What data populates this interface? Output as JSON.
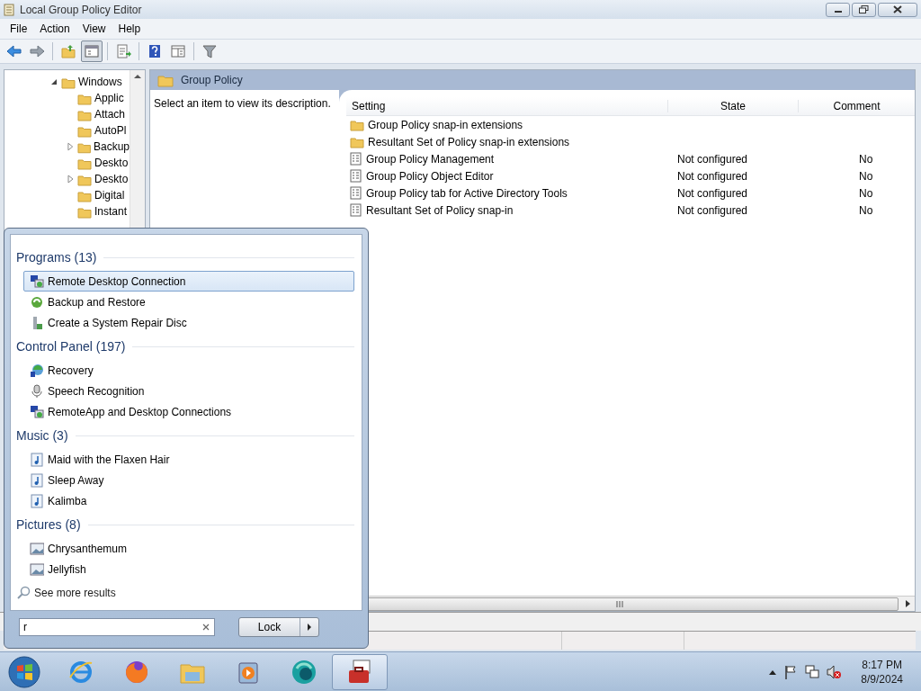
{
  "window": {
    "title": "Local Group Policy Editor"
  },
  "menu": [
    "File",
    "Action",
    "View",
    "Help"
  ],
  "toolbar": [
    [
      {
        "kind": "back"
      },
      {
        "kind": "forward"
      }
    ],
    [
      {
        "kind": "up"
      },
      {
        "kind": "tree",
        "pressed": true
      }
    ],
    [
      {
        "kind": "export"
      }
    ],
    [
      {
        "kind": "help"
      },
      {
        "kind": "panes"
      }
    ],
    [
      {
        "kind": "filter"
      }
    ]
  ],
  "tree": [
    {
      "label": "Windows",
      "expanded": true,
      "children": [
        {
          "label": "Applic",
          "expandable": false
        },
        {
          "label": "Attach",
          "expandable": false
        },
        {
          "label": "AutoPl",
          "expandable": false
        },
        {
          "label": "Backup",
          "expandable": true
        },
        {
          "label": "Deskto",
          "expandable": false
        },
        {
          "label": "Deskto",
          "expandable": true
        },
        {
          "label": "Digital",
          "expandable": false
        },
        {
          "label": "Instant",
          "expandable": false
        }
      ]
    }
  ],
  "details": {
    "header": "Group Policy",
    "description": "Select an item to view its description.",
    "columns": [
      "Setting",
      "State",
      "Comment"
    ],
    "rows": [
      {
        "kind": "folder",
        "setting": "Group Policy snap-in extensions"
      },
      {
        "kind": "folder",
        "setting": "Resultant Set of Policy snap-in extensions"
      },
      {
        "kind": "policy",
        "setting": "Group Policy Management",
        "state": "Not configured",
        "comment": "No"
      },
      {
        "kind": "policy",
        "setting": "Group Policy Object Editor",
        "state": "Not configured",
        "comment": "No"
      },
      {
        "kind": "policy",
        "setting": "Group Policy tab for Active Directory Tools",
        "state": "Not configured",
        "comment": "No"
      },
      {
        "kind": "policy",
        "setting": "Resultant Set of Policy snap-in",
        "state": "Not configured",
        "comment": "No"
      }
    ]
  },
  "start_menu": {
    "groups": [
      {
        "title": "Programs (13)",
        "items": [
          {
            "kind": "remote",
            "label": "Remote Desktop Connection",
            "selected": true
          },
          {
            "kind": "backup",
            "label": "Backup and Restore",
            "selected": false
          },
          {
            "kind": "repair",
            "label": "Create a System Repair Disc",
            "selected": false
          }
        ]
      },
      {
        "title": "Control Panel (197)",
        "items": [
          {
            "kind": "recovery",
            "label": "Recovery",
            "selected": false
          },
          {
            "kind": "speech",
            "label": "Speech Recognition",
            "selected": false
          },
          {
            "kind": "remote",
            "label": "RemoteApp and Desktop Connections",
            "selected": false
          }
        ]
      },
      {
        "title": "Music (3)",
        "items": [
          {
            "kind": "music",
            "label": "Maid with the Flaxen Hair",
            "selected": false
          },
          {
            "kind": "music",
            "label": "Sleep Away",
            "selected": false
          },
          {
            "kind": "music",
            "label": "Kalimba",
            "selected": false
          }
        ]
      },
      {
        "title": "Pictures (8)",
        "items": [
          {
            "kind": "picture",
            "label": "Chrysanthemum",
            "selected": false
          },
          {
            "kind": "picture",
            "label": "Jellyfish",
            "selected": false
          }
        ]
      }
    ],
    "see_more": "See more results",
    "search": {
      "value": "r"
    },
    "lock_button": "Lock"
  },
  "taskbar": {
    "apps": [
      {
        "kind": "ie",
        "active": false
      },
      {
        "kind": "firefox",
        "active": false
      },
      {
        "kind": "explorer",
        "active": false
      },
      {
        "kind": "media",
        "active": false
      },
      {
        "kind": "edge",
        "active": false
      },
      {
        "kind": "toolbox",
        "active": true
      }
    ],
    "time": "8:17 PM",
    "date": "8/9/2024"
  }
}
